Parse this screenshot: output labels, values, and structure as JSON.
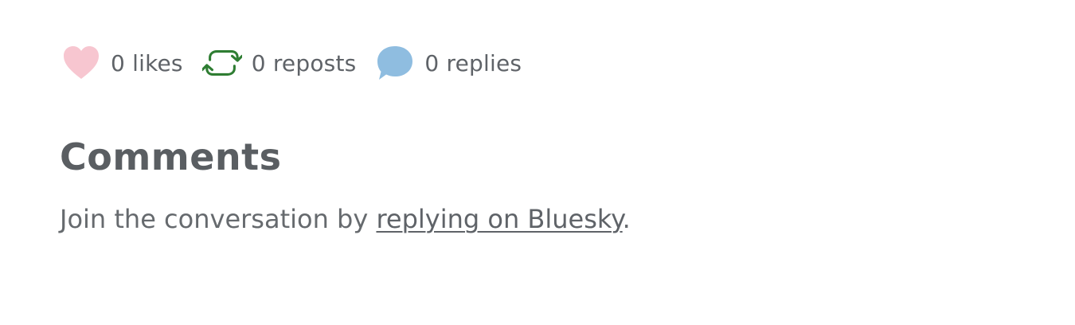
{
  "stats": {
    "likes": {
      "icon": "heart-icon",
      "label": "0 likes",
      "color": "#f7c6d0"
    },
    "reposts": {
      "icon": "repost-icon",
      "label": "0 reposts",
      "color": "#2e7d32"
    },
    "replies": {
      "icon": "speech-bubble-icon",
      "label": "0 replies",
      "color": "#8fbde0"
    }
  },
  "comments": {
    "heading": "Comments",
    "text_before": "Join the conversation by ",
    "link_text": "replying on Bluesky",
    "text_after": "."
  }
}
